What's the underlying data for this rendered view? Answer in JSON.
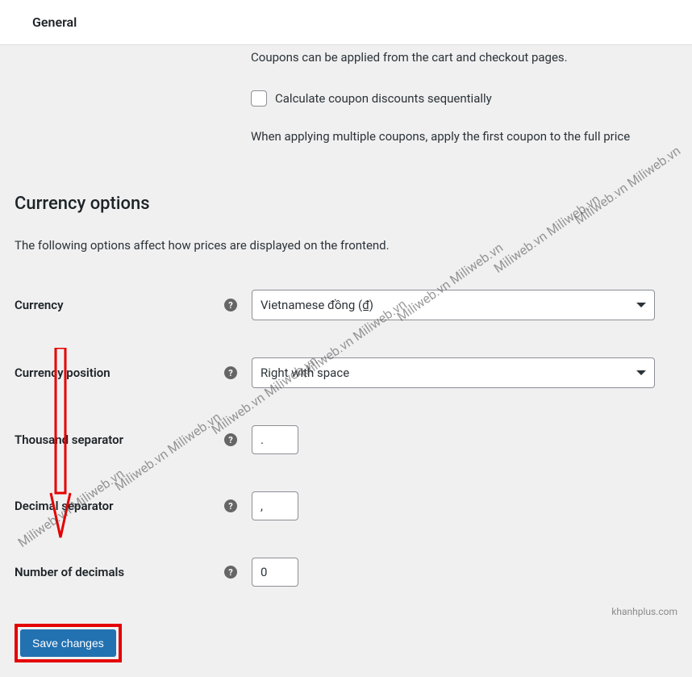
{
  "top": {
    "tab_general": "General"
  },
  "coupon": {
    "desc": "Coupons can be applied from the cart and checkout pages.",
    "calc_sequential": "Calculate coupon discounts sequentially",
    "calc_help": "When applying multiple coupons, apply the first coupon to the full price"
  },
  "currency": {
    "heading": "Currency options",
    "desc": "The following options affect how prices are displayed on the frontend.",
    "currency_label": "Currency",
    "currency_value": "Vietnamese đồng (₫)",
    "position_label": "Currency position",
    "position_value": "Right with space",
    "thousand_label": "Thousand separator",
    "thousand_value": ".",
    "decimal_label": "Decimal separator",
    "decimal_value": ",",
    "numdec_label": "Number of decimals",
    "numdec_value": "0"
  },
  "buttons": {
    "save": "Save changes"
  },
  "watermark": {
    "text": "Miliweb.vn Miliweb.vn"
  },
  "footer": {
    "credit": "khanhplus.com"
  }
}
